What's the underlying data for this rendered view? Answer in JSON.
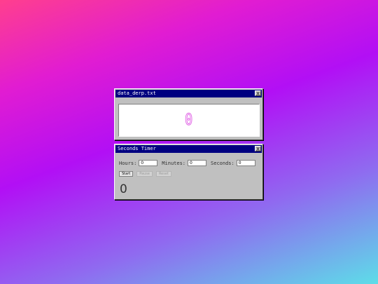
{
  "window1": {
    "title": "data_derp.txt",
    "close": "X",
    "display_value": "0"
  },
  "window2": {
    "title": "Seconds Timer",
    "close": "X",
    "fields": {
      "hours_label": "Hours:",
      "hours_value": "0",
      "minutes_label": "Minutes:",
      "minutes_value": "0",
      "seconds_label": "Seconds:",
      "seconds_value": "0"
    },
    "buttons": {
      "start": "Start",
      "pause": "Pause",
      "reset": "Reset"
    },
    "counter": "0"
  }
}
